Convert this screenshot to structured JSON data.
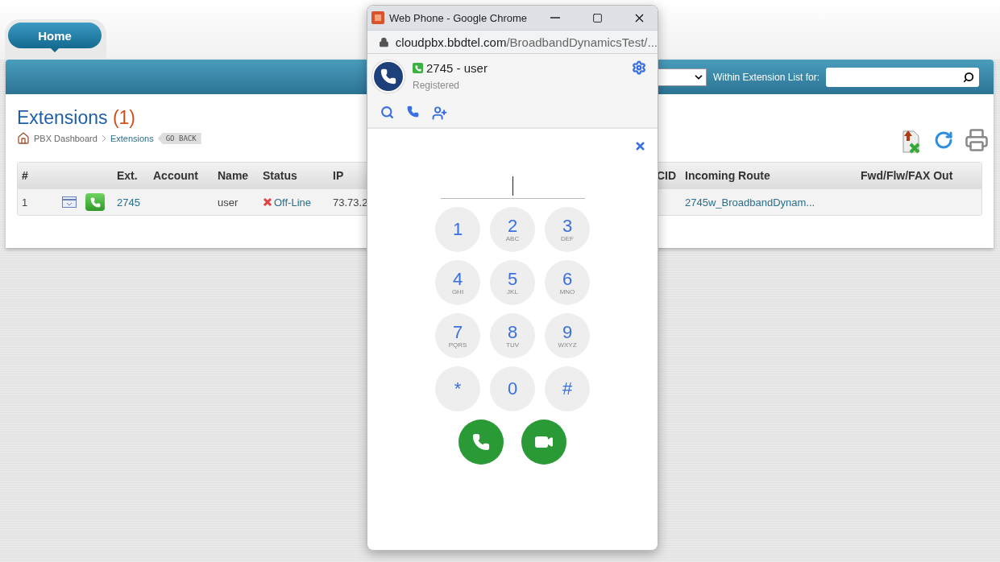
{
  "nav_tab": {
    "label": "Home"
  },
  "toolbar": {
    "search_label": "Within Extension List for:"
  },
  "page": {
    "title": "Extensions",
    "count": "(1)",
    "breadcrumb": [
      "PBX Dashboard",
      "Extensions"
    ],
    "go_back": "GO BACK"
  },
  "table": {
    "columns": {
      "number": "#",
      "ext": "Ext.",
      "account": "Account",
      "name": "Name",
      "status": "Status",
      "ip": "IP",
      "cid": "CID",
      "incoming_route": "Incoming Route",
      "forward": "Fwd/Flw/FAX Out"
    },
    "rows": [
      {
        "number": "1",
        "ext": "2745",
        "name": "user",
        "status": "Off-Line",
        "online": false,
        "ip": "73.73.2",
        "incoming_route": "2745w_BroadbandDynam..."
      }
    ]
  },
  "phone": {
    "window_title": "Web Phone - Google Chrome",
    "url_host": "cloudpbx.bbdtel.com",
    "url_path": "/BroadbandDynamicsTest/...",
    "user": "2745 - user",
    "registration": "Registered",
    "registered": true,
    "keys": [
      {
        "digit": "1"
      },
      {
        "digit": "2",
        "letters": "ABC"
      },
      {
        "digit": "3",
        "letters": "DEF"
      },
      {
        "digit": "4",
        "letters": "GHI"
      },
      {
        "digit": "5",
        "letters": "JKL"
      },
      {
        "digit": "6",
        "letters": "MNO"
      },
      {
        "digit": "7",
        "letters": "PQRS"
      },
      {
        "digit": "8",
        "letters": "TUV"
      },
      {
        "digit": "9",
        "letters": "WXYZ"
      },
      {
        "digit": "*"
      },
      {
        "digit": "0"
      },
      {
        "digit": "#"
      }
    ]
  }
}
